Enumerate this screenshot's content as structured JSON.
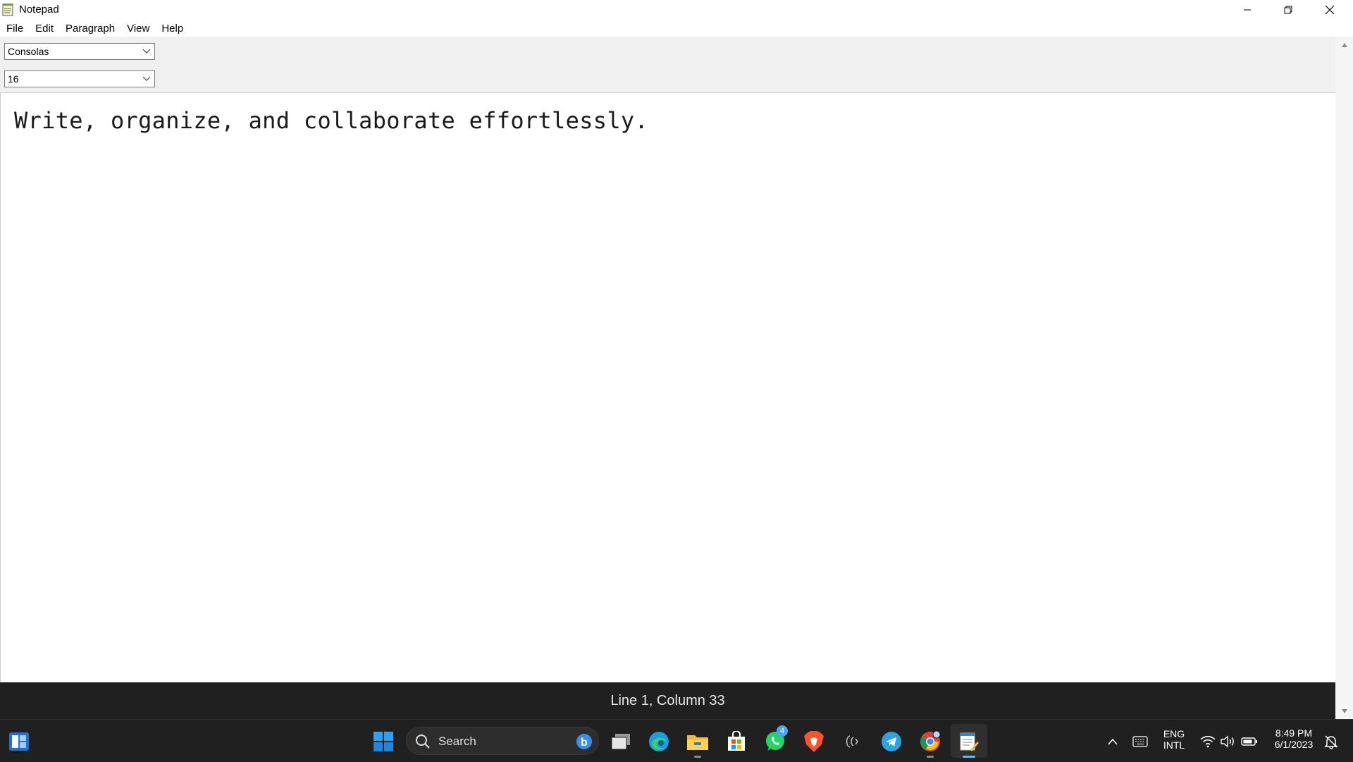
{
  "window": {
    "title": "Notepad",
    "icon": "notepad-icon",
    "controls": [
      "minimize-icon",
      "maximize-icon",
      "close-icon"
    ]
  },
  "menu": {
    "items": [
      {
        "label": "File"
      },
      {
        "label": "Edit"
      },
      {
        "label": "Paragraph"
      },
      {
        "label": "View"
      },
      {
        "label": "Help"
      }
    ]
  },
  "toolbar": {
    "font_family": {
      "value": "Consolas"
    },
    "font_size": {
      "value": "16"
    }
  },
  "editor": {
    "content": "Write, organize, and collaborate effortlessly."
  },
  "status": {
    "position": "Line 1, Column 33"
  },
  "taskbar": {
    "search_label": "Search",
    "whatsapp_badge": "4",
    "language": {
      "line1": "ENG",
      "line2": "INTL"
    },
    "clock": {
      "time": "8:49 PM",
      "date": "6/1/2023"
    }
  },
  "colors": {
    "taskbar_bg": "#202020",
    "status_bg": "#202020",
    "toolbar_bg": "#f0f0f0",
    "windows_blue": "#0078d4"
  }
}
